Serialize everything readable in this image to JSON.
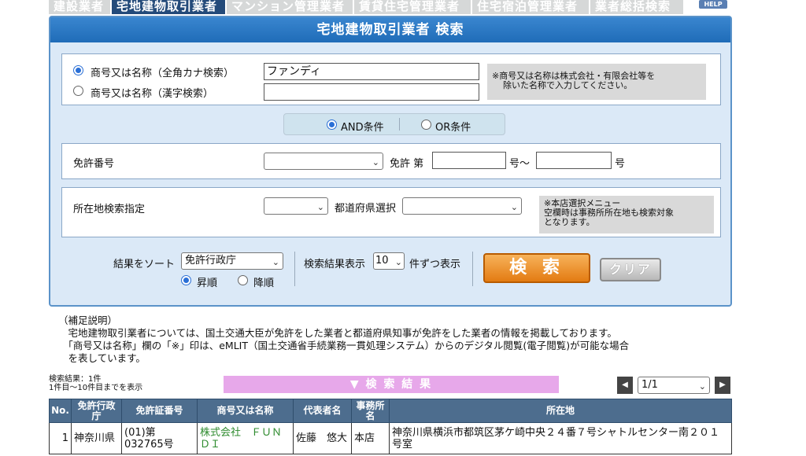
{
  "tabs": [
    "建設業者",
    "宅地建物取引業者",
    "マンション管理業者",
    "賃貸住宅管理業者",
    "住宅宿泊管理業者",
    "業者総括検索"
  ],
  "help_label": "HELP",
  "form": {
    "title": "宅地建物取引業者 検索",
    "name_kana_label": "商号又は名称（全角カナ検索）",
    "name_kanji_label": "商号又は名称（漢字検索）",
    "name_kana_value": "ファンディ",
    "name_kanji_value": "",
    "name_note_1": "※商号又は名称は株式会社・有限会社等を",
    "name_note_2": "除いた名称で入力してください。",
    "and_label": "AND条件",
    "or_label": "OR条件",
    "license_label": "免許番号",
    "license_select": "",
    "license_prefix": "免許 第",
    "license_from": "",
    "license_mid": "号〜",
    "license_to": "",
    "license_suffix": "号",
    "location_label": "所在地検索指定",
    "location_select": "",
    "pref_label": "都道府県選択",
    "pref_select": "",
    "location_note_1": "※本店選択メニュー",
    "location_note_2": "空欄時は事務所所在地も検索対象",
    "location_note_3": "となります。",
    "sort_label": "結果をソート",
    "sort_value": "免許行政庁",
    "asc_label": "昇順",
    "desc_label": "降順",
    "per_page_label": "検索結果表示",
    "per_page_value": "10",
    "per_page_suffix": "件ずつ表示",
    "search_label": "検 索",
    "clear_label": "クリア"
  },
  "notes": [
    "（補足説明）",
    "　宅地建物取引業者については、国土交通大臣が免許をした業者と都道府県知事が免許をした業者の情報を掲載しております。",
    "　「商号又は名称」欄の「※」印は、eMLIT（国土交通省手続業務一貫処理システム）からのデジタル閲覧(電子閲覧)が可能な場合",
    "　を表しています。"
  ],
  "results": {
    "count_text": "検索結果：1件",
    "range_text": "1件目〜10件目までを表示",
    "bar_label": "▼ 検 索 結 果",
    "page_value": "1/1",
    "headers": [
      "No.",
      "免許行政庁",
      "免許証番号",
      "商号又は名称",
      "代表者名",
      "事務所名",
      "所在地"
    ],
    "rows": [
      {
        "no": "1",
        "authority": "神奈川県",
        "license": "(01)第032765号",
        "name": "株式会社　ＦＵＮＤＩ",
        "rep": "佐藤　悠大",
        "office": "本店",
        "address": "神奈川県横浜市都筑区茅ケ崎中央２４番７号シャトルセンター南２０１号室"
      }
    ]
  },
  "colors": {
    "tab_active": "#244b7a",
    "panel_title": "#2a78c4",
    "search_button": "#e88a22",
    "results_bar": "#e7a8ea",
    "table_header": "#4d6d8e"
  }
}
